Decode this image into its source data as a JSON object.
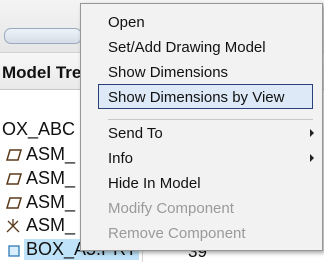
{
  "tree": {
    "header": "Model Tree",
    "rows": [
      {
        "name": "OX_ABC",
        "icon": "assembly-root-icon"
      },
      {
        "name": "ASM_",
        "icon": "datum-plane-icon"
      },
      {
        "name": "ASM_",
        "icon": "datum-plane-icon"
      },
      {
        "name": "ASM_",
        "icon": "datum-plane-icon"
      },
      {
        "name": "ASM_",
        "icon": "coordinate-system-icon"
      },
      {
        "name": "BOX_A5.PRT",
        "icon": "part-icon"
      }
    ],
    "quantity_value": "39"
  },
  "context_menu": {
    "items": [
      {
        "label": "Open",
        "enabled": true
      },
      {
        "label": "Set/Add Drawing Model",
        "enabled": true
      },
      {
        "label": "Show Dimensions",
        "enabled": true
      },
      {
        "label": "Show Dimensions by View",
        "enabled": true,
        "highlighted": true
      },
      {
        "label": "Send To",
        "enabled": true,
        "submenu": true
      },
      {
        "label": "Info",
        "enabled": true,
        "submenu": true
      },
      {
        "label": "Hide In Model",
        "enabled": true
      },
      {
        "label": "Modify Component",
        "enabled": false
      },
      {
        "label": "Remove Component",
        "enabled": false
      }
    ]
  },
  "colors": {
    "selection": "#bfe3f8",
    "menu_background": "#f2f2f2",
    "highlight_border": "#2b3f7a",
    "disabled_text": "#9a9a9a"
  }
}
